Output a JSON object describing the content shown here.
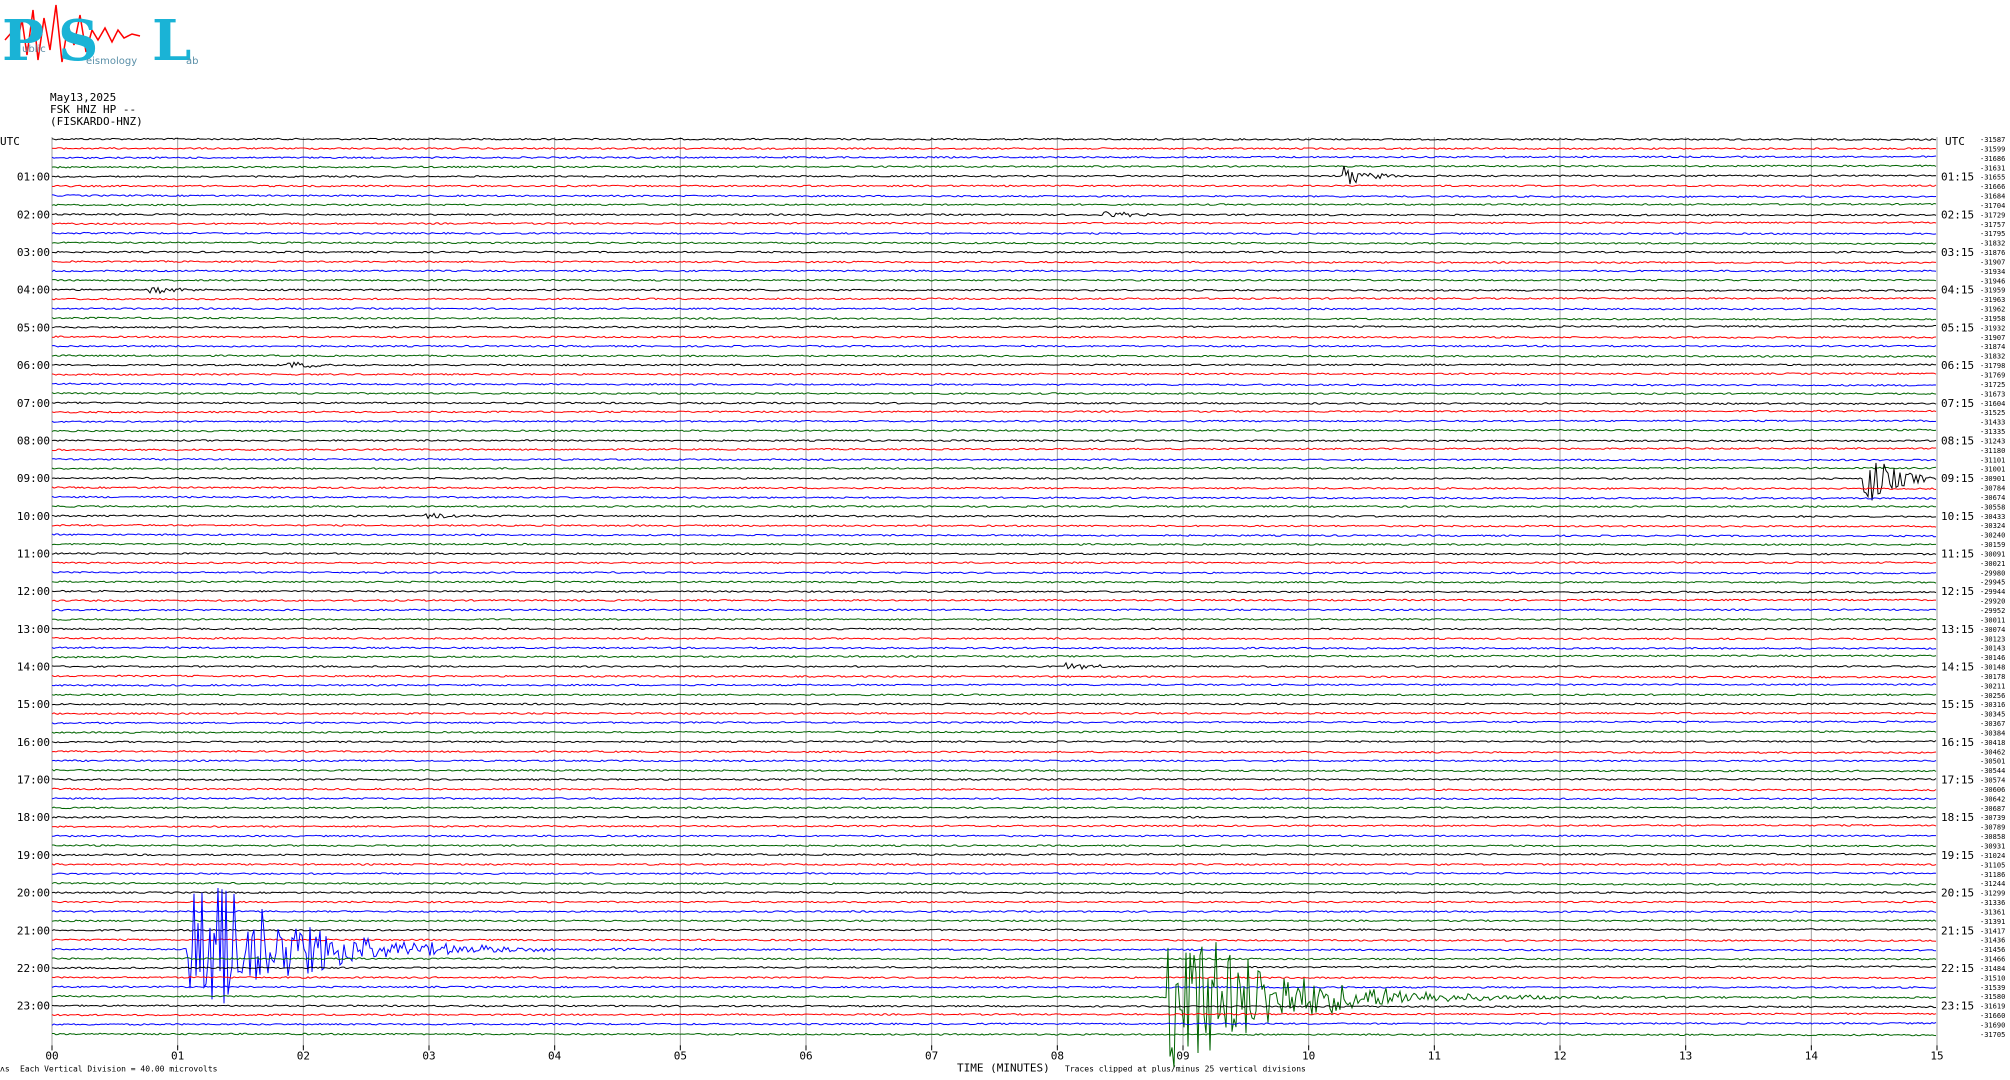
{
  "logo": {
    "P": "P",
    "S": "S",
    "L": "L",
    "word1": "ublic",
    "word2": "eismology",
    "word3": "ab"
  },
  "header": {
    "date": "May13,2025",
    "station": "FSK HNZ HP --",
    "site": "(FISKARDO-HNZ)"
  },
  "utc_label": "UTC",
  "left_times": [
    "01:00",
    "02:00",
    "03:00",
    "04:00",
    "05:00",
    "06:00",
    "07:00",
    "08:00",
    "09:00",
    "10:00",
    "11:00",
    "12:00",
    "13:00",
    "14:00",
    "15:00",
    "16:00",
    "17:00",
    "18:00",
    "19:00",
    "20:00",
    "21:00",
    "22:00",
    "23:00"
  ],
  "right_times": [
    "01:15",
    "02:15",
    "03:15",
    "04:15",
    "05:15",
    "06:15",
    "07:15",
    "08:15",
    "09:15",
    "10:15",
    "11:15",
    "12:15",
    "13:15",
    "14:15",
    "15:15",
    "16:15",
    "17:15",
    "18:15",
    "19:15",
    "20:15",
    "21:15",
    "22:15",
    "23:15"
  ],
  "offsets": [
    "-31587",
    "-31599",
    "-31686",
    "-31631",
    "-31655",
    "-31666",
    "-31684",
    "-31704",
    "-31729",
    "-31757",
    "-31795",
    "-31832",
    "-31876",
    "-31907",
    "-31934",
    "-31946",
    "-31959",
    "-31963",
    "-31962",
    "-31958",
    "-31932",
    "-31907",
    "-31874",
    "-31832",
    "-31798",
    "-31769",
    "-31725",
    "-31673",
    "-31604",
    "-31525",
    "-31433",
    "-31335",
    "-31243",
    "-31180",
    "-31101",
    "-31001",
    "-30901",
    "-30784",
    "-30674",
    "-30558",
    "-30433",
    "-30324",
    "-30240",
    "-30159",
    "-30091",
    "-30021",
    "-29980",
    "-29945",
    "-29944",
    "-29920",
    "-29952",
    "-30011",
    "-30074",
    "-30123",
    "-30143",
    "-30146",
    "-30148",
    "-30178",
    "-30211",
    "-30256",
    "-30316",
    "-30345",
    "-30367",
    "-30384",
    "-30418",
    "-30462",
    "-30501",
    "-30544",
    "-30574",
    "-30606",
    "-30642",
    "-30687",
    "-30739",
    "-30789",
    "-30858",
    "-30931",
    "-31024",
    "-31105",
    "-31186",
    "-31244",
    "-31299",
    "-31336",
    "-31361",
    "-31391",
    "-31417",
    "-31436",
    "-31456",
    "-31466",
    "-31484",
    "-31510",
    "-31539",
    "-31580",
    "-31619",
    "-31660",
    "-31690",
    "-31705"
  ],
  "x_ticks": [
    "00",
    "01",
    "02",
    "03",
    "04",
    "05",
    "06",
    "07",
    "08",
    "09",
    "10",
    "11",
    "12",
    "13",
    "14",
    "15"
  ],
  "footer": {
    "left_mark": "ʌs",
    "division": "Each Vertical Division =   40.00 microvolts",
    "xlabel": "TIME (MINUTES)",
    "clip_note": "Traces clipped at plus/minus 25 vertical divisions"
  },
  "colors": {
    "trace": [
      "#000000",
      "#ff0000",
      "#0000ff",
      "#006400"
    ],
    "grid": "#a0a0a0",
    "logo": "#1ab3d6",
    "logo_wave": "#ff0000"
  },
  "chart_data": {
    "type": "line",
    "title": "",
    "xlabel": "TIME (MINUTES)",
    "ylabel": "",
    "xlim": [
      0,
      15
    ],
    "rows": 96,
    "minutes_per_row": 15,
    "trace_colors_cycle": [
      "black",
      "red",
      "blue",
      "green"
    ],
    "events": [
      {
        "row_time": "01:00",
        "minute": 10.3,
        "color": "black",
        "amplitude_divisions": 3
      },
      {
        "row_time": "02:00",
        "minute": 8.4,
        "color": "black",
        "amplitude_divisions": 1
      },
      {
        "row_time": "04:00",
        "minute": 0.8,
        "color": "red",
        "amplitude_divisions": 1
      },
      {
        "row_time": "06:00",
        "minute": 1.9,
        "color": "blue",
        "amplitude_divisions": 1
      },
      {
        "row_time": "09:00",
        "minute": 14.45,
        "color": "blue",
        "amplitude_divisions": 8
      },
      {
        "row_time": "10:00",
        "minute": 3.0,
        "color": "black",
        "amplitude_divisions": 1
      },
      {
        "row_time": "14:00",
        "minute": 8.1,
        "color": "blue",
        "amplitude_divisions": 1
      },
      {
        "row_time": "21:30",
        "minute": 1.1,
        "color": "red",
        "amplitude_divisions": 25
      },
      {
        "row_time": "22:45",
        "minute": 8.9,
        "color": "green",
        "amplitude_divisions": 25
      }
    ]
  }
}
